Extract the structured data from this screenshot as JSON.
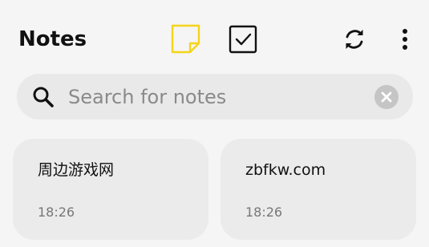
{
  "app": {
    "title": "Notes"
  },
  "toolbar": {
    "notes_tab_icon": "sticky-note-icon",
    "tasks_tab_icon": "checkbox-icon",
    "sync_icon": "sync-icon",
    "menu_icon": "more-vertical-icon",
    "notes_accent": "#f5d419"
  },
  "search": {
    "placeholder": "Search for notes",
    "value": "",
    "search_icon": "search-icon",
    "clear_icon": "clear-icon"
  },
  "notes": [
    {
      "title": "周边游戏网",
      "time": "18:26"
    },
    {
      "title": "zbfkw.com",
      "time": "18:26"
    }
  ]
}
